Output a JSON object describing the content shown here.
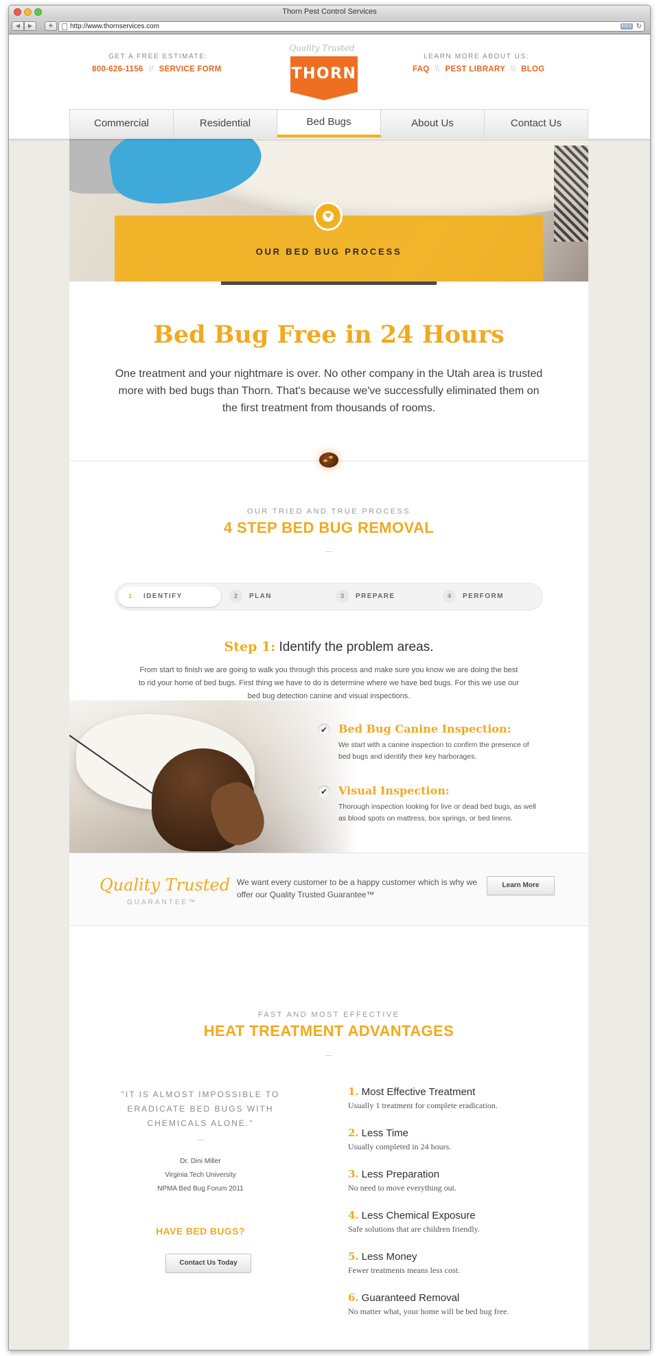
{
  "browser": {
    "window_title": "Thorn Pest Control Services",
    "url": "http://www.thornservices.com",
    "rss_label": "RSS"
  },
  "header": {
    "estimate_label": "GET A FREE ESTIMATE:",
    "phone": "800-626-1156",
    "service_form": "SERVICE FORM",
    "separator": "//",
    "learn_label": "LEARN MORE ABOUT US:",
    "faq": "FAQ",
    "pest_library": "PEST LIBRARY",
    "blog": "BLOG",
    "link_separator": "\\\\",
    "logo_tagline": "Quality Trusted",
    "logo_text": "THORN"
  },
  "nav": {
    "items": [
      {
        "label": "Commercial"
      },
      {
        "label": "Residential"
      },
      {
        "label": "Bed Bugs"
      },
      {
        "label": "About Us"
      },
      {
        "label": "Contact Us"
      }
    ],
    "active_index": 2
  },
  "hero": {
    "band_text": "OUR BED BUG PROCESS"
  },
  "intro": {
    "headline": "Bed Bug Free in 24 Hours",
    "body": "One treatment and your nightmare is over. No other company in the Utah area is trusted more with bed bugs than Thorn. That's because we've successfully eliminated them on the first treatment from thousands of rooms."
  },
  "process": {
    "kicker": "OUR TRIED AND TRUE PROCESS",
    "title": "4 STEP BED BUG REMOVAL",
    "steps": [
      {
        "num": "1",
        "label": "IDENTIFY"
      },
      {
        "num": "2",
        "label": "PLAN"
      },
      {
        "num": "3",
        "label": "PREPARE"
      },
      {
        "num": "4",
        "label": "PERFORM"
      }
    ],
    "step_lead": "Step 1:",
    "step_heading": "Identify the problem areas.",
    "step_body": "From start to finish we are going to walk you through this process and make sure you know we are doing the best to rid your home of bed bugs. First thing we have to do is determine where we have bed bugs. For this we use our bed bug detection canine and visual inspections.",
    "features": [
      {
        "title": "Bed Bug Canine Inspection:",
        "desc": "We start with a canine inspection to confirm the presence of bed bugs and identify their key harborages."
      },
      {
        "title": "Visual Inspection:",
        "desc": "Thorough inspection looking for live or dead bed bugs, as well as blood spots on mattress, box springs, or bed linens."
      }
    ],
    "check_glyph": "✔"
  },
  "guarantee": {
    "script": "Quality Trusted",
    "sub": "GUARANTEE™",
    "text": "We want every customer to be a happy customer which is why we offer our Quality Trusted Guarantee™",
    "button": "Learn More"
  },
  "heat": {
    "kicker": "FAST AND MOST EFFECTIVE",
    "title": "HEAT TREATMENT ADVANTAGES",
    "quote": "\"IT IS ALMOST IMPOSSIBLE TO ERADICATE BED BUGS WITH CHEMICALS ALONE.\"",
    "attrib_name": "Dr. Dini Miller",
    "attrib_org": "Virginia Tech University",
    "attrib_event": "NPMA Bed Bug Forum 2011",
    "cta_heading": "HAVE BED BUGS?",
    "cta_button": "Contact Us Today",
    "advantages": [
      {
        "num": "1.",
        "title": "Most Effective Treatment",
        "desc": "Usually 1 treatment for complete eradication."
      },
      {
        "num": "2.",
        "title": "Less Time",
        "desc": "Usually completed in 24 hours."
      },
      {
        "num": "3.",
        "title": "Less Preparation",
        "desc": "No need to move everything out."
      },
      {
        "num": "4.",
        "title": "Less Chemical Exposure",
        "desc": "Safe solutions that are children friendly."
      },
      {
        "num": "5.",
        "title": "Less Money",
        "desc": "Fewer treatments means less cost."
      },
      {
        "num": "6.",
        "title": "Guaranteed Removal",
        "desc": "No matter what, your home will be bed bug free."
      }
    ]
  },
  "colors": {
    "accent_orange": "#e8651e",
    "accent_gold": "#f2a91e",
    "logo_orange": "#ef6f22"
  }
}
